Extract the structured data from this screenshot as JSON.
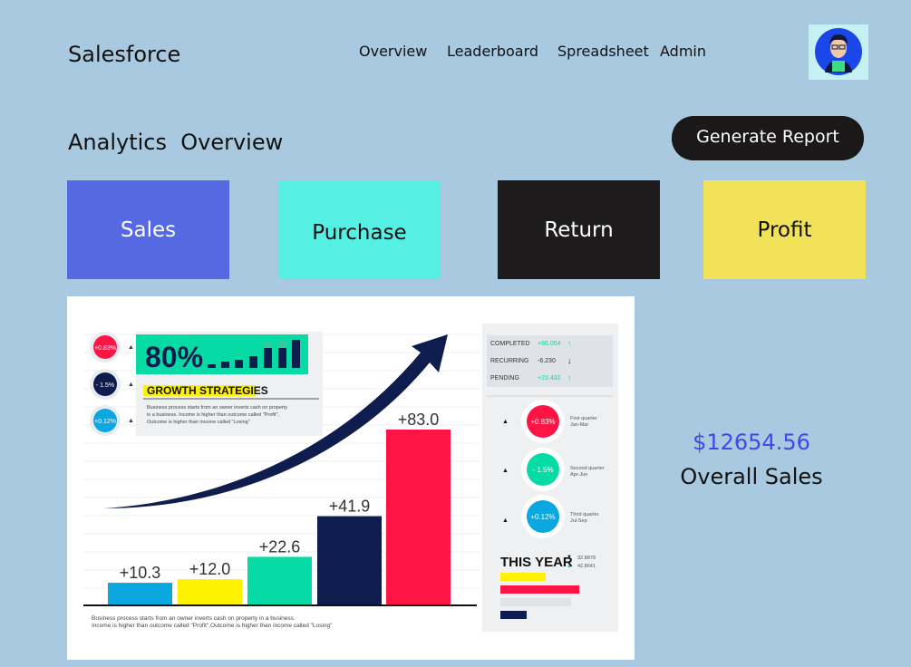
{
  "header": {
    "brand": "Salesforce",
    "nav": [
      "Overview",
      "Leaderboard",
      "Spreadsheet",
      "Admin"
    ]
  },
  "page": {
    "title": "Analytics  Overview",
    "generate_button": "Generate Report"
  },
  "tiles": [
    {
      "label": "Sales",
      "color": "#5569e3"
    },
    {
      "label": "Purchase",
      "color": "#55efe4"
    },
    {
      "label": "Return",
      "color": "#1d1b1b"
    },
    {
      "label": "Profit",
      "color": "#f1e25a"
    }
  ],
  "infographic": {
    "headline_percent": "80%",
    "headline_title": "GROWTH STRATEGIES",
    "headline_desc": [
      "Business process starts from an owner inverts cash on property",
      "in a business. Income is higher than outcome called \"Profit\",",
      "Outcome is higher than income called \"Losing\""
    ],
    "badges": [
      "+0.83%",
      "- 1.5%",
      "+0.12%"
    ],
    "bars": [
      {
        "label": "+10.3",
        "value": 10.3,
        "color": "#0aa7e0"
      },
      {
        "label": "+12.0",
        "value": 12.0,
        "color": "#fff200"
      },
      {
        "label": "+22.6",
        "value": 22.6,
        "color": "#06dba6"
      },
      {
        "label": "+41.9",
        "value": 41.9,
        "color": "#0f1d4e"
      },
      {
        "label": "+83.0",
        "value": 83.0,
        "color": "#ff1446"
      }
    ],
    "footnote": [
      "Business process starts from an owner inverts cash on property in a business.",
      "Income is higher than outcome called \"Profit\",Outcome is higher than income called \"Losing\""
    ],
    "status_rows": [
      {
        "label": "COMPLETED",
        "value": "+86.054"
      },
      {
        "label": "RECURRING",
        "value": "-6.230"
      },
      {
        "label": "PENDING",
        "value": "+23.432"
      }
    ],
    "quarters": [
      {
        "value": "+0.83%",
        "name": "First quarter",
        "range": "Jan-Mar",
        "color": "#ff1446"
      },
      {
        "value": "- 1.5%",
        "name": "Second quarter",
        "range": "Apr-Jun",
        "color": "#06dba6"
      },
      {
        "value": "+0.12%",
        "name": "Third quarter",
        "range": "Jul-Sep",
        "color": "#0aa7e0"
      }
    ],
    "this_year": {
      "label": "THIS YEAR",
      "stats": [
        "32.8878",
        "42.8641"
      ]
    }
  },
  "overall": {
    "value": "$12654.56",
    "label": "Overall Sales"
  }
}
